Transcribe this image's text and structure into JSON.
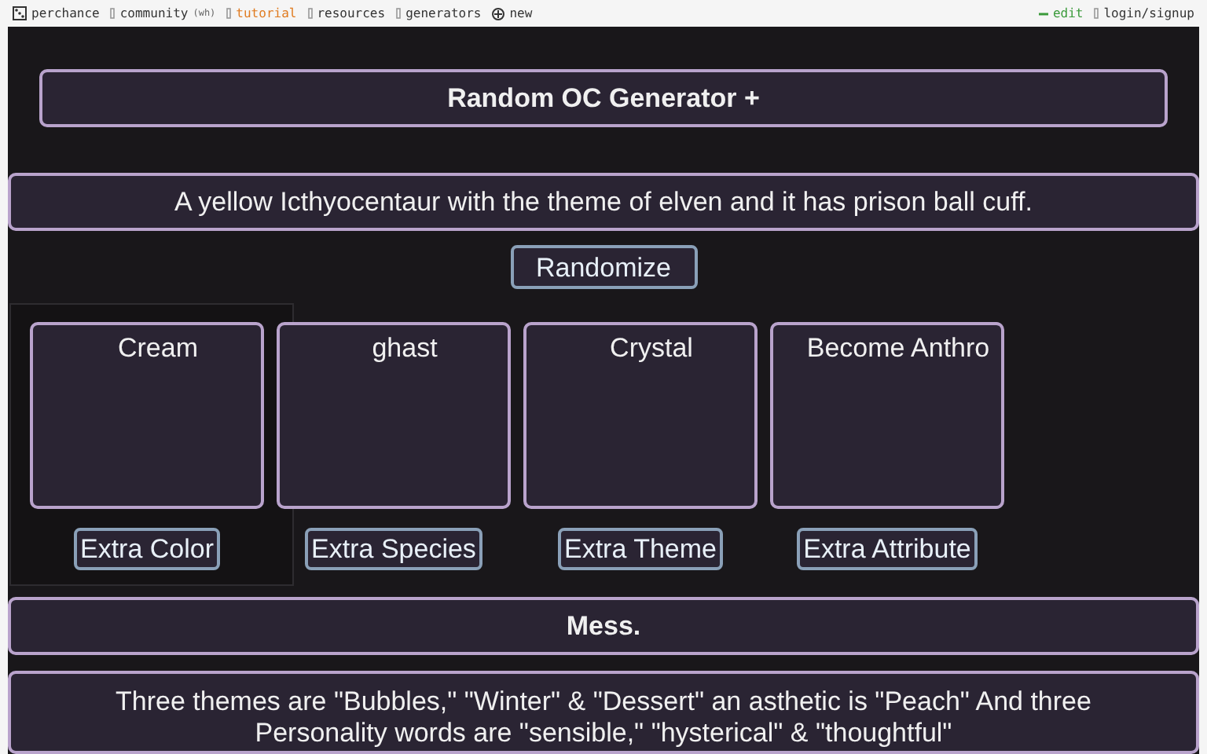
{
  "nav": {
    "left": [
      {
        "label": "perchance",
        "kind": "dice",
        "selected": false
      },
      {
        "label": "community",
        "kind": "box",
        "badge": "(wh)",
        "selected": false
      },
      {
        "label": "tutorial",
        "kind": "box",
        "selected": true
      },
      {
        "label": "resources",
        "kind": "box",
        "selected": false
      },
      {
        "label": "generators",
        "kind": "box",
        "selected": false
      },
      {
        "label": "new",
        "kind": "plus",
        "selected": false
      }
    ],
    "right": [
      {
        "label": "edit",
        "kind": "pencil"
      },
      {
        "label": "login/signup",
        "kind": "box"
      }
    ]
  },
  "title": "Random OC Generator +",
  "description": "A yellow Icthyocentaur with the theme of elven and it has prison ball cuff.",
  "randomize_button": "Randomize",
  "slots": [
    {
      "value": "Cream",
      "button": "Extra Color"
    },
    {
      "value": "ghast",
      "button": "Extra Species"
    },
    {
      "value": "Crystal",
      "button": "Extra Theme"
    },
    {
      "value": "Become Anthro",
      "button": "Extra Attribute"
    }
  ],
  "mess_heading": "Mess.",
  "mess_text": "Three themes are \"Bubbles,\" \"Winter\" & \"Dessert\" an asthetic is \"Peach\" And three Personality words are \"sensible,\" \"hysterical\" & \"thoughtful\""
}
